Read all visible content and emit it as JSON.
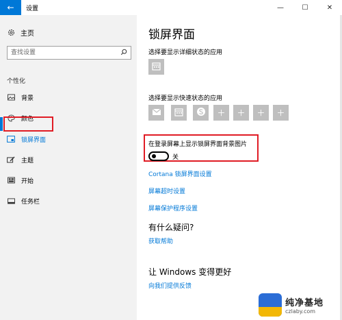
{
  "window": {
    "title": "设置",
    "back_glyph": "←",
    "minimize_glyph": "—",
    "maximize_glyph": "☐",
    "close_glyph": "✕"
  },
  "sidebar": {
    "home_label": "主页",
    "search": {
      "placeholder": "查找设置"
    },
    "section_label": "个性化",
    "items": [
      {
        "label": "背景",
        "icon": "picture-icon"
      },
      {
        "label": "颜色",
        "icon": "palette-icon"
      },
      {
        "label": "锁屏界面",
        "icon": "lock-screen-icon",
        "active": true
      },
      {
        "label": "主题",
        "icon": "brush-icon"
      },
      {
        "label": "开始",
        "icon": "start-icon"
      },
      {
        "label": "任务栏",
        "icon": "taskbar-icon"
      }
    ]
  },
  "main": {
    "title": "锁屏界面",
    "detailed_status_label": "选择要显示详细状态的应用",
    "quick_status_label": "选择要显示快速状态的应用",
    "quick_tiles": [
      "mail-icon",
      "calendar-icon",
      "skype-icon",
      "plus-icon",
      "plus-icon",
      "plus-icon",
      "plus-icon"
    ],
    "toggle": {
      "label": "在登录屏幕上显示锁屏界面背景图片",
      "state_text": "关",
      "on": false
    },
    "links": [
      "Cortana 锁屏界面设置",
      "屏幕超时设置",
      "屏幕保护程序设置"
    ],
    "questions_title": "有什么疑问?",
    "get_help": "获取帮助",
    "improve_title": "让 Windows 变得更好",
    "feedback": "向我们提供反馈"
  },
  "watermark": {
    "name": "纯净基地",
    "url": "czlaby.com"
  },
  "colors": {
    "accent": "#0078d7",
    "highlight": "#e01b24",
    "tile": "#bfbfbf"
  }
}
